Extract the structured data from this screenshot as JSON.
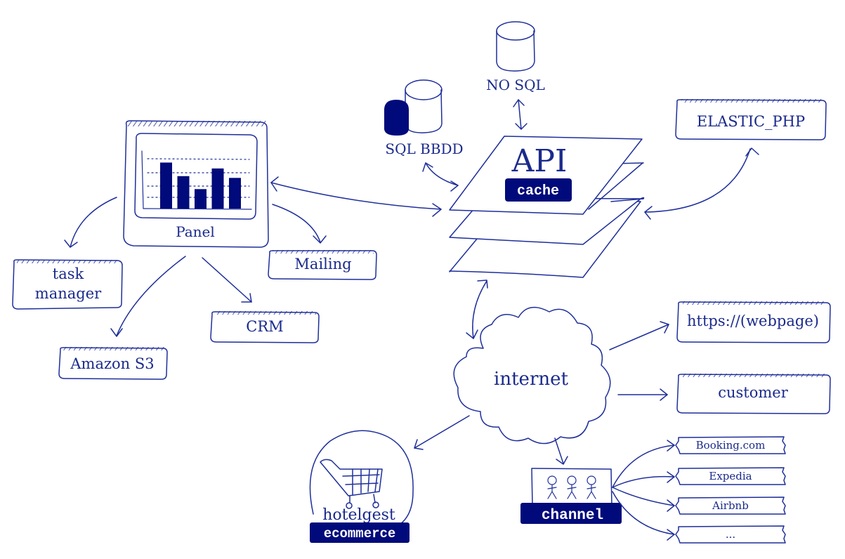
{
  "diagram": {
    "colors": {
      "ink": "#1f2f9a",
      "fill_dark": "#000a7a",
      "background": "#ffffff",
      "label_text_on_dark": "#ffffff"
    },
    "panel": {
      "label": "Panel",
      "mini_chart": {
        "type": "bar",
        "values": [
          0.78,
          0.55,
          0.33,
          0.68,
          0.52
        ],
        "note": "decorative bar-chart glyph inside the Panel box (relative heights)"
      }
    },
    "api": {
      "title": "API",
      "badge": "cache"
    },
    "databases": {
      "nosql": "NO SQL",
      "sql": "SQL BBDD"
    },
    "services": {
      "elastic": "ELASTIC_PHP",
      "task_manager_line1": "task",
      "task_manager_line2": "manager",
      "mailing": "Mailing",
      "crm": "CRM",
      "amazon_s3": "Amazon S3",
      "webpage": "https://(webpage)",
      "customer": "customer"
    },
    "internet": {
      "label": "internet"
    },
    "ecommerce": {
      "brand": "hotelgest",
      "badge": "ecommerce"
    },
    "channel": {
      "badge": "channel",
      "ota_list": [
        "Booking.com",
        "Expedia",
        "Airbnb",
        "..."
      ]
    },
    "connections": [
      {
        "from": "Panel",
        "to": "API",
        "direction": "both"
      },
      {
        "from": "SQL BBDD",
        "to": "API",
        "direction": "both"
      },
      {
        "from": "NO SQL",
        "to": "API",
        "direction": "both"
      },
      {
        "from": "ELASTIC_PHP",
        "to": "API",
        "direction": "both"
      },
      {
        "from": "API",
        "to": "internet",
        "direction": "both"
      },
      {
        "from": "Panel",
        "to": "task manager",
        "direction": "forward"
      },
      {
        "from": "Panel",
        "to": "Mailing",
        "direction": "forward"
      },
      {
        "from": "Panel",
        "to": "CRM",
        "direction": "forward"
      },
      {
        "from": "Panel",
        "to": "Amazon S3",
        "direction": "forward"
      },
      {
        "from": "internet",
        "to": "https://(webpage)",
        "direction": "forward"
      },
      {
        "from": "internet",
        "to": "customer",
        "direction": "forward"
      },
      {
        "from": "internet",
        "to": "ecommerce",
        "direction": "forward"
      },
      {
        "from": "internet",
        "to": "channel",
        "direction": "forward"
      },
      {
        "from": "channel",
        "to": "Booking.com",
        "direction": "forward"
      },
      {
        "from": "channel",
        "to": "Expedia",
        "direction": "forward"
      },
      {
        "from": "channel",
        "to": "Airbnb",
        "direction": "forward"
      },
      {
        "from": "channel",
        "to": "...",
        "direction": "forward"
      }
    ]
  }
}
